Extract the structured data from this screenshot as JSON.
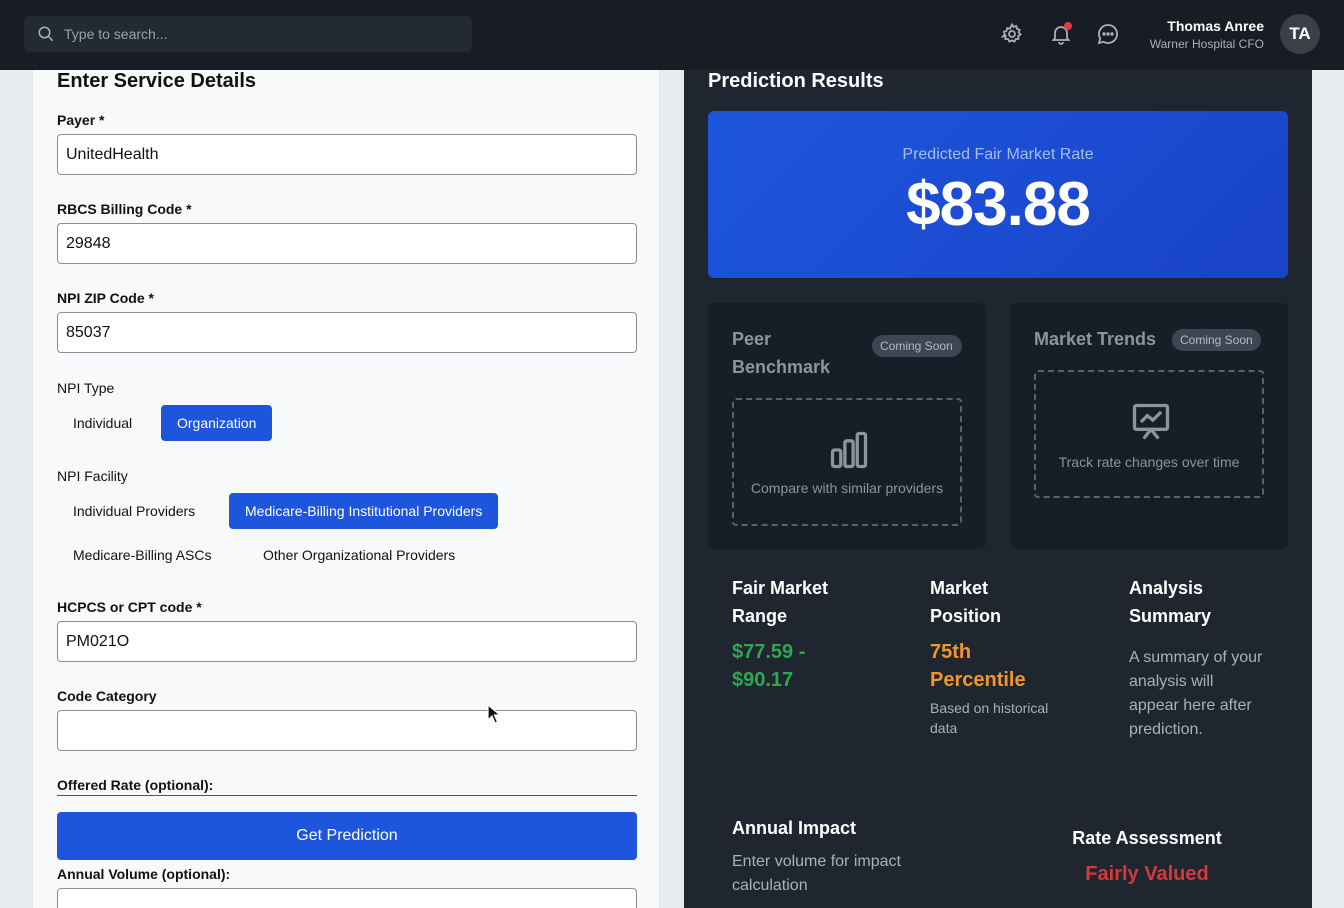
{
  "header": {
    "search_placeholder": "Type to search...",
    "user_name": "Thomas Anree",
    "user_role": "Warner Hospital CFO",
    "avatar_initials": "TA",
    "icons": [
      "search-icon",
      "gear-icon",
      "bell-icon",
      "chat-icon"
    ]
  },
  "form": {
    "title": "Enter Service Details",
    "payer_label": "Payer *",
    "payer_value": "UnitedHealth",
    "rbcs_label": "RBCS Billing Code *",
    "rbcs_value": "29848",
    "zip_label": "NPI ZIP Code *",
    "zip_value": "85037",
    "npi_type_label": "NPI Type",
    "npi_type_options": [
      "Individual",
      "Organization"
    ],
    "npi_type_selected": "Organization",
    "npi_facility_label": "NPI Facility",
    "npi_facility_options": [
      "Individual Providers",
      "Medicare-Billing Institutional Providers",
      "Medicare-Billing ASCs",
      "Other Organizational Providers"
    ],
    "npi_facility_selected": "Medicare-Billing Institutional Providers",
    "hcpcs_label": "HCPCS or CPT code *",
    "hcpcs_value": "PM021O",
    "category_label": "Code Category",
    "category_value": "",
    "offered_rate_label": "Offered Rate (optional):",
    "annual_volume_label": "Annual Volume (optional):",
    "submit_label": "Get Prediction"
  },
  "results": {
    "title": "Prediction Results",
    "rate_label": "Predicted Fair Market Rate",
    "rate_value": "$83.88",
    "peer_title": "Peer Benchmark",
    "peer_badge": "Coming Soon",
    "peer_text": "Compare with similar providers",
    "trends_title": "Market Trends",
    "trends_badge": "Coming Soon",
    "trends_text": "Track rate changes over time",
    "range_title": "Fair Market Range",
    "range_value": "$77.59 - $90.17",
    "position_title": "Market Position",
    "position_value": "75th Percentile",
    "position_sub": "Based on historical data",
    "summary_title": "Analysis Summary",
    "summary_text": "A summary of your analysis will appear here after prediction.",
    "impact_title": "Annual Impact",
    "impact_text": "Enter volume for impact calculation",
    "assessment_title": "Rate Assessment",
    "assessment_value": "Fairly Valued"
  },
  "colors": {
    "accent": "#1d56dc",
    "range_green": "#2ea652",
    "position_orange": "#f0962a",
    "assessment_red": "#d23b3b",
    "notification_dot": "#e53e3e"
  }
}
